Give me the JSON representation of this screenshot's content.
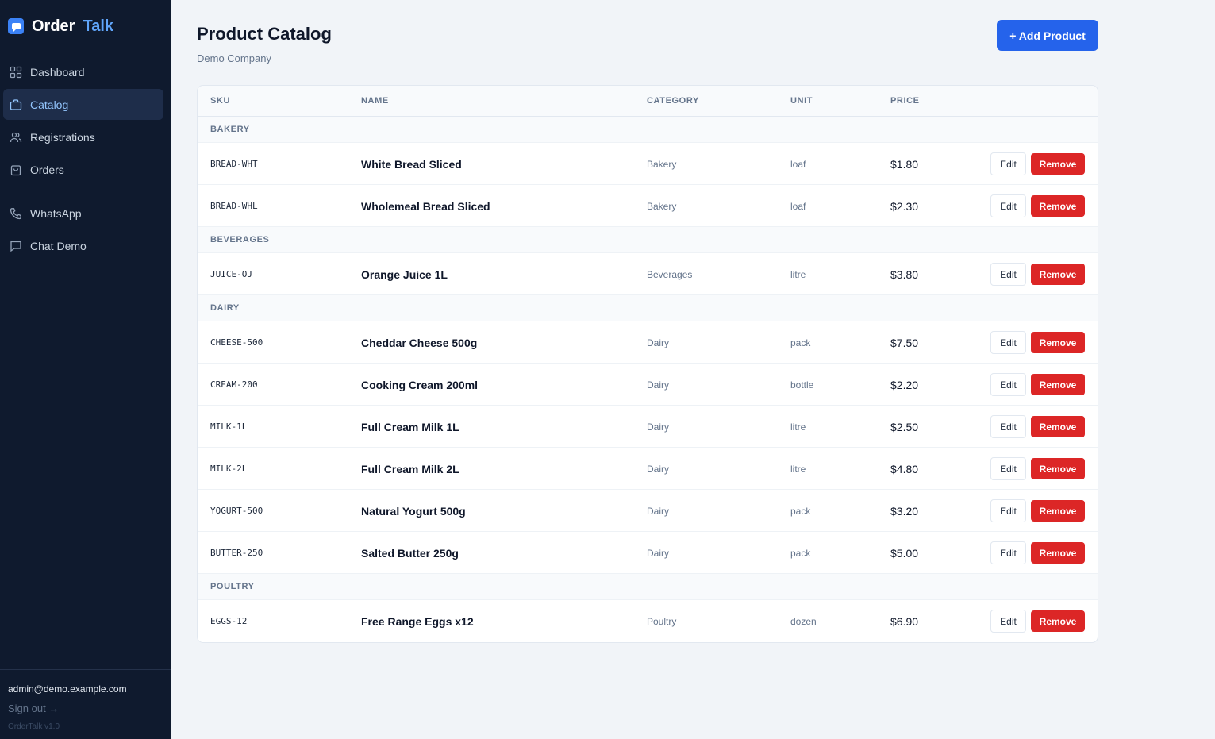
{
  "brand": {
    "part1": "Order",
    "part2": "Talk"
  },
  "nav": [
    {
      "key": "dashboard",
      "label": "Dashboard",
      "icon": "grid-icon",
      "active": false
    },
    {
      "key": "catalog",
      "label": "Catalog",
      "icon": "briefcase-icon",
      "active": true
    },
    {
      "key": "registrations",
      "label": "Registrations",
      "icon": "users-icon",
      "active": false
    },
    {
      "key": "orders",
      "label": "Orders",
      "icon": "bag-icon",
      "active": false
    },
    {
      "key": "whatsapp",
      "label": "WhatsApp",
      "icon": "phone-icon",
      "active": false
    },
    {
      "key": "chat-demo",
      "label": "Chat Demo",
      "icon": "chat-icon",
      "active": false
    }
  ],
  "footer": {
    "email": "admin@demo.example.com",
    "signout": "Sign out →",
    "version": "OrderTalk v1.0"
  },
  "page": {
    "title": "Product Catalog",
    "subtitle": "Demo Company",
    "add_button": "+ Add Product"
  },
  "table": {
    "headers": {
      "sku": "SKU",
      "name": "NAME",
      "category": "CATEGORY",
      "unit": "UNIT",
      "price": "PRICE"
    },
    "edit_label": "Edit",
    "remove_label": "Remove",
    "groups": [
      {
        "name": "BAKERY",
        "rows": [
          {
            "sku": "BREAD-WHT",
            "name": "White Bread Sliced",
            "category": "Bakery",
            "unit": "loaf",
            "price": "$1.80"
          },
          {
            "sku": "BREAD-WHL",
            "name": "Wholemeal Bread Sliced",
            "category": "Bakery",
            "unit": "loaf",
            "price": "$2.30"
          }
        ]
      },
      {
        "name": "BEVERAGES",
        "rows": [
          {
            "sku": "JUICE-OJ",
            "name": "Orange Juice 1L",
            "category": "Beverages",
            "unit": "litre",
            "price": "$3.80"
          }
        ]
      },
      {
        "name": "DAIRY",
        "rows": [
          {
            "sku": "CHEESE-500",
            "name": "Cheddar Cheese 500g",
            "category": "Dairy",
            "unit": "pack",
            "price": "$7.50"
          },
          {
            "sku": "CREAM-200",
            "name": "Cooking Cream 200ml",
            "category": "Dairy",
            "unit": "bottle",
            "price": "$2.20"
          },
          {
            "sku": "MILK-1L",
            "name": "Full Cream Milk 1L",
            "category": "Dairy",
            "unit": "litre",
            "price": "$2.50"
          },
          {
            "sku": "MILK-2L",
            "name": "Full Cream Milk 2L",
            "category": "Dairy",
            "unit": "litre",
            "price": "$4.80"
          },
          {
            "sku": "YOGURT-500",
            "name": "Natural Yogurt 500g",
            "category": "Dairy",
            "unit": "pack",
            "price": "$3.20"
          },
          {
            "sku": "BUTTER-250",
            "name": "Salted Butter 250g",
            "category": "Dairy",
            "unit": "pack",
            "price": "$5.00"
          }
        ]
      },
      {
        "name": "POULTRY",
        "rows": [
          {
            "sku": "EGGS-12",
            "name": "Free Range Eggs x12",
            "category": "Poultry",
            "unit": "dozen",
            "price": "$6.90"
          }
        ]
      }
    ]
  },
  "colors": {
    "sidebar_bg": "#0f1a2e",
    "accent": "#2563eb",
    "brand_accent": "#60a5fa",
    "danger": "#dc2626",
    "page_bg": "#f1f4f8"
  }
}
